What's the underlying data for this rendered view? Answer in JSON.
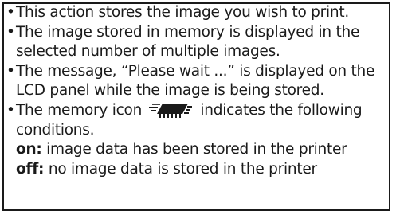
{
  "notes": {
    "items": [
      "This action stores the image you wish to print.",
      "The image stored in memory is displayed in the selected number of multiple images.",
      "The message, “Please wait ...” is displayed on the LCD panel while the image is being stored."
    ],
    "memory_item": {
      "before_icon": "The memory icon",
      "after_icon": "indicates the following conditions.",
      "icon": "memory-chip-icon",
      "conditions": [
        {
          "key": "on:",
          "text": "image data has been stored in the printer"
        },
        {
          "key": "off:",
          "text": "no image data is stored in the printer"
        }
      ]
    }
  }
}
